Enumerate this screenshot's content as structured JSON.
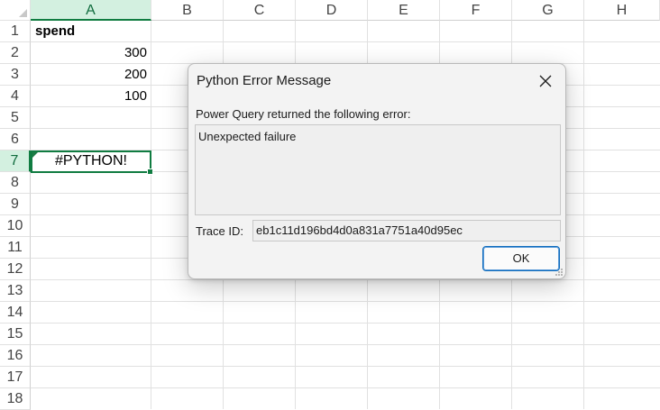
{
  "sheet": {
    "columns": [
      "A",
      "B",
      "C",
      "D",
      "E",
      "F",
      "G",
      "H"
    ],
    "rows": [
      "1",
      "2",
      "3",
      "4",
      "5",
      "6",
      "7",
      "8",
      "9",
      "10",
      "11",
      "12",
      "13",
      "14",
      "15",
      "16",
      "17",
      "18"
    ],
    "active_column": "A",
    "active_row": "7",
    "cells": {
      "a1": "spend",
      "a2": "300",
      "a3": "200",
      "a4": "100",
      "a7": "#PYTHON!"
    }
  },
  "dialog": {
    "title": "Python Error Message",
    "error_label": "Power Query returned the following error:",
    "error_message": "Unexpected failure",
    "trace_label": "Trace ID:",
    "trace_id": "eb1c11d196bd4d0a831a7751a40d95ec",
    "ok_label": "OK",
    "close_icon": "close-icon"
  },
  "colors": {
    "accent": "#107c41",
    "selected_header": "#d3f0e0",
    "dialog_background": "#f3f3f3",
    "ok_border": "#0f6cbd"
  }
}
